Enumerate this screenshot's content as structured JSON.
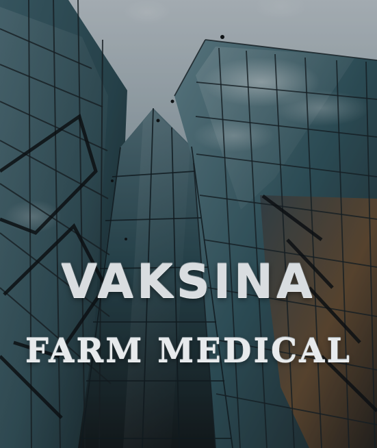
{
  "brand": {
    "title": "VAKSINA",
    "subtitle": "FARM MEDICAL"
  },
  "background": {
    "scene": "glass-skyscrapers",
    "sky_color": "#9bb2bf",
    "glass_color": "#335762",
    "frame_color": "#1b2429",
    "highlight_color": "#cfd7dc",
    "accent_reflection_color": "#8a5d2d"
  }
}
